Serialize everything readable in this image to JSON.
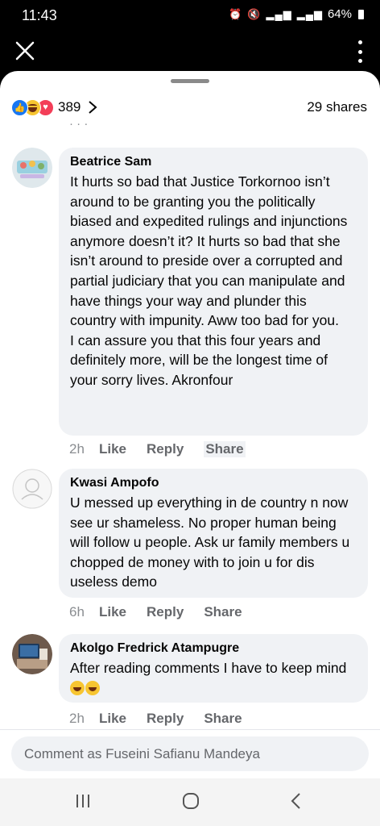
{
  "status_bar": {
    "time": "11:43",
    "icons": [
      "alarm-icon",
      "mute-icon",
      "signal-icon",
      "wifi-signal-icon"
    ],
    "battery": "64%"
  },
  "header": {
    "close_icon": "close-icon",
    "menu_icon": "more-options-icon"
  },
  "reactions": {
    "types": [
      "like",
      "haha",
      "love"
    ],
    "count": "389",
    "shares": "29 shares"
  },
  "comments": [
    {
      "author": "Beatrice Sam",
      "text": "It hurts so bad that Justice Torkornoo isn’t around to be granting you the politically biased and expedited rulings and injunctions anymore doesn’t it? It hurts so bad that she isn’t around to preside over a corrupted and partial judiciary that you can manipulate and have things your way and plunder this country with impunity. Aww too bad for you.\nI can assure you that this four years and definitely more, will be the longest time of your sorry lives. Akronfour",
      "time": "2h",
      "like": "Like",
      "reply": "Reply",
      "share": "Share"
    },
    {
      "author": "Kwasi Ampofo",
      "text": "U messed up everything in de country n now see ur shameless. No proper human being will follow u people. Ask ur family members u chopped de money with to join u for dis useless demo",
      "time": "6h",
      "like": "Like",
      "reply": "Reply",
      "share": "Share"
    },
    {
      "author": "Akolgo Fredrick Atampugre",
      "text": "After reading comments I have to keep mind",
      "time": "2h",
      "like": "Like",
      "reply": "Reply",
      "share": "Share"
    }
  ],
  "comment_box": {
    "placeholder": "Comment as Fuseini Safianu Mandeya"
  },
  "navigation": {
    "buttons": [
      "recent-apps",
      "home",
      "back"
    ]
  }
}
